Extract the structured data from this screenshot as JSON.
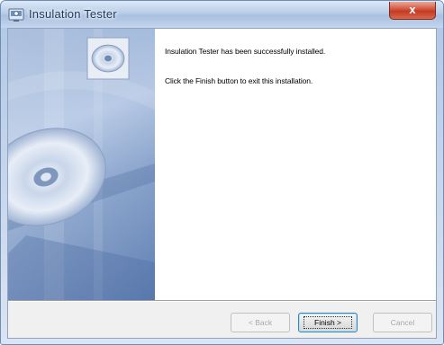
{
  "window": {
    "title": "Insulation Tester",
    "close_glyph": "x",
    "icons": {
      "app": "installer-app-icon",
      "close": "close-icon",
      "banner": "cd-disc-icon",
      "art": "cd-disc-artwork"
    },
    "colors": {
      "titlebar": "#b8cde8",
      "close": "#c23b22",
      "side_panel": "#7f9ecb",
      "content": "#ffffff"
    }
  },
  "content": {
    "message_installed": "Insulation Tester has been successfully installed.",
    "message_finish": "Click the Finish button to exit this installation."
  },
  "buttons": {
    "back": "< Back",
    "finish": "Finish >",
    "cancel": "Cancel"
  }
}
